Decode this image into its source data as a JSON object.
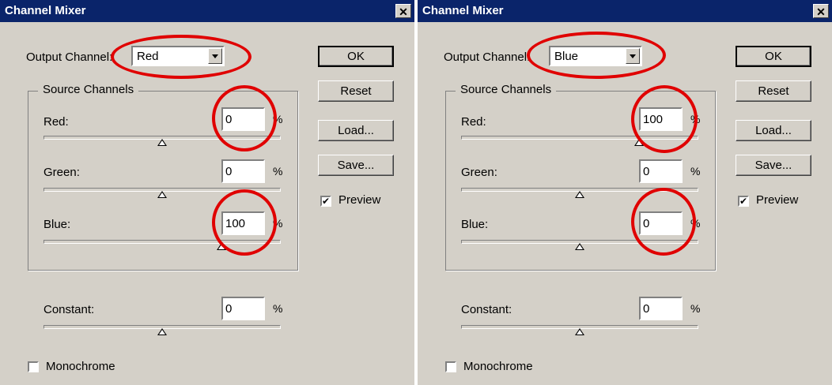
{
  "dialogs": [
    {
      "title": "Channel Mixer",
      "close_label": "✕",
      "output_channel_label": "Output Channel:",
      "output_channel_value": "Red",
      "source_channels_label": "Source Channels",
      "red_label": "Red:",
      "red_value": "0",
      "red_fraction": 0.5,
      "green_label": "Green:",
      "green_value": "0",
      "green_fraction": 0.5,
      "blue_label": "Blue:",
      "blue_value": "100",
      "blue_fraction": 0.75,
      "constant_label": "Constant:",
      "constant_value": "0",
      "constant_fraction": 0.5,
      "percent_sign": "%",
      "ok_label": "OK",
      "reset_label": "Reset",
      "load_label": "Load...",
      "save_label": "Save...",
      "preview_label": "Preview",
      "preview_checked": true,
      "monochrome_label": "Monochrome",
      "monochrome_checked": false
    },
    {
      "title": "Channel Mixer",
      "close_label": "✕",
      "output_channel_label": "Output Channel:",
      "output_channel_value": "Blue",
      "source_channels_label": "Source Channels",
      "red_label": "Red:",
      "red_value": "100",
      "red_fraction": 0.75,
      "green_label": "Green:",
      "green_value": "0",
      "green_fraction": 0.5,
      "blue_label": "Blue:",
      "blue_value": "0",
      "blue_fraction": 0.5,
      "constant_label": "Constant:",
      "constant_value": "0",
      "constant_fraction": 0.5,
      "percent_sign": "%",
      "ok_label": "OK",
      "reset_label": "Reset",
      "load_label": "Load...",
      "save_label": "Save...",
      "preview_label": "Preview",
      "preview_checked": true,
      "monochrome_label": "Monochrome",
      "monochrome_checked": false
    }
  ],
  "colors": {
    "titlebar": "#0a246a",
    "dialog_bg": "#d4d0c8",
    "highlight_ring": "#e00000"
  }
}
